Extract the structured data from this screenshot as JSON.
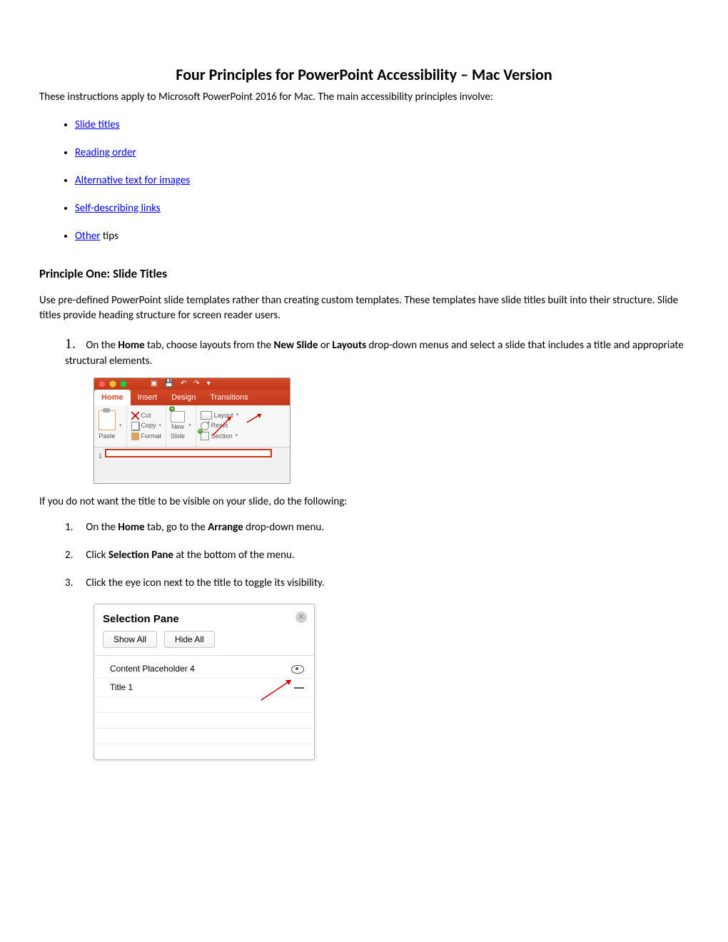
{
  "title": "Four Principles for PowerPoint Accessibility – Mac Version",
  "intro": "These instructions apply to Microsoft PowerPoint 2016 for Mac. The main accessibility principles involve:",
  "principles_list": {
    "i0": "Slide titles",
    "i1": "Reading order",
    "i2": "Alternative text for images",
    "i3": "Self-describing links",
    "i4_link": "Other",
    "i4_rest": " tips"
  },
  "p1": {
    "heading": "Principle One: Slide Titles",
    "body": "Use pre-defined PowerPoint slide templates rather than creating custom templates. These templates have slide titles built into their structure. Slide titles provide heading structure for screen reader users.",
    "step1_num": "1.",
    "step1_a": "On the ",
    "step1_b": "Home",
    "step1_c": " tab, choose layouts from the ",
    "step1_d": "New Slide",
    "step1_e": " or ",
    "step1_f": "Layouts",
    "step1_g": " drop-down menus and select a slide that includes a title and appropriate structural elements."
  },
  "ribbon": {
    "tab_home": "Home",
    "tab_insert": "Insert",
    "tab_design": "Design",
    "tab_transitions": "Transitions",
    "paste": "Paste",
    "cut": "Cut",
    "copy": "Copy",
    "format": "Format",
    "new_slide_label1": "New",
    "new_slide_label2": "Slide",
    "layout": "Layout",
    "reset": "Reset",
    "section": "Section",
    "slide_num": "1"
  },
  "hide_intro": "If you do not want the title to be visible on your slide, do the following:",
  "hide_steps": {
    "n1": "1.",
    "s1a": "On the ",
    "s1b": "Home",
    "s1c": " tab, go to the ",
    "s1d": "Arrange",
    "s1e": " drop-down menu.",
    "n2": "2.",
    "s2a": "Click ",
    "s2b": "Selection Pane",
    "s2c": " at the bottom of the menu.",
    "n3": "3.",
    "s3": "Click the eye icon next to the title to toggle its visibility."
  },
  "selection_pane": {
    "title": "Selection Pane",
    "show_all": "Show All",
    "hide_all": "Hide All",
    "item1": "Content Placeholder 4",
    "item2": "Title 1"
  }
}
